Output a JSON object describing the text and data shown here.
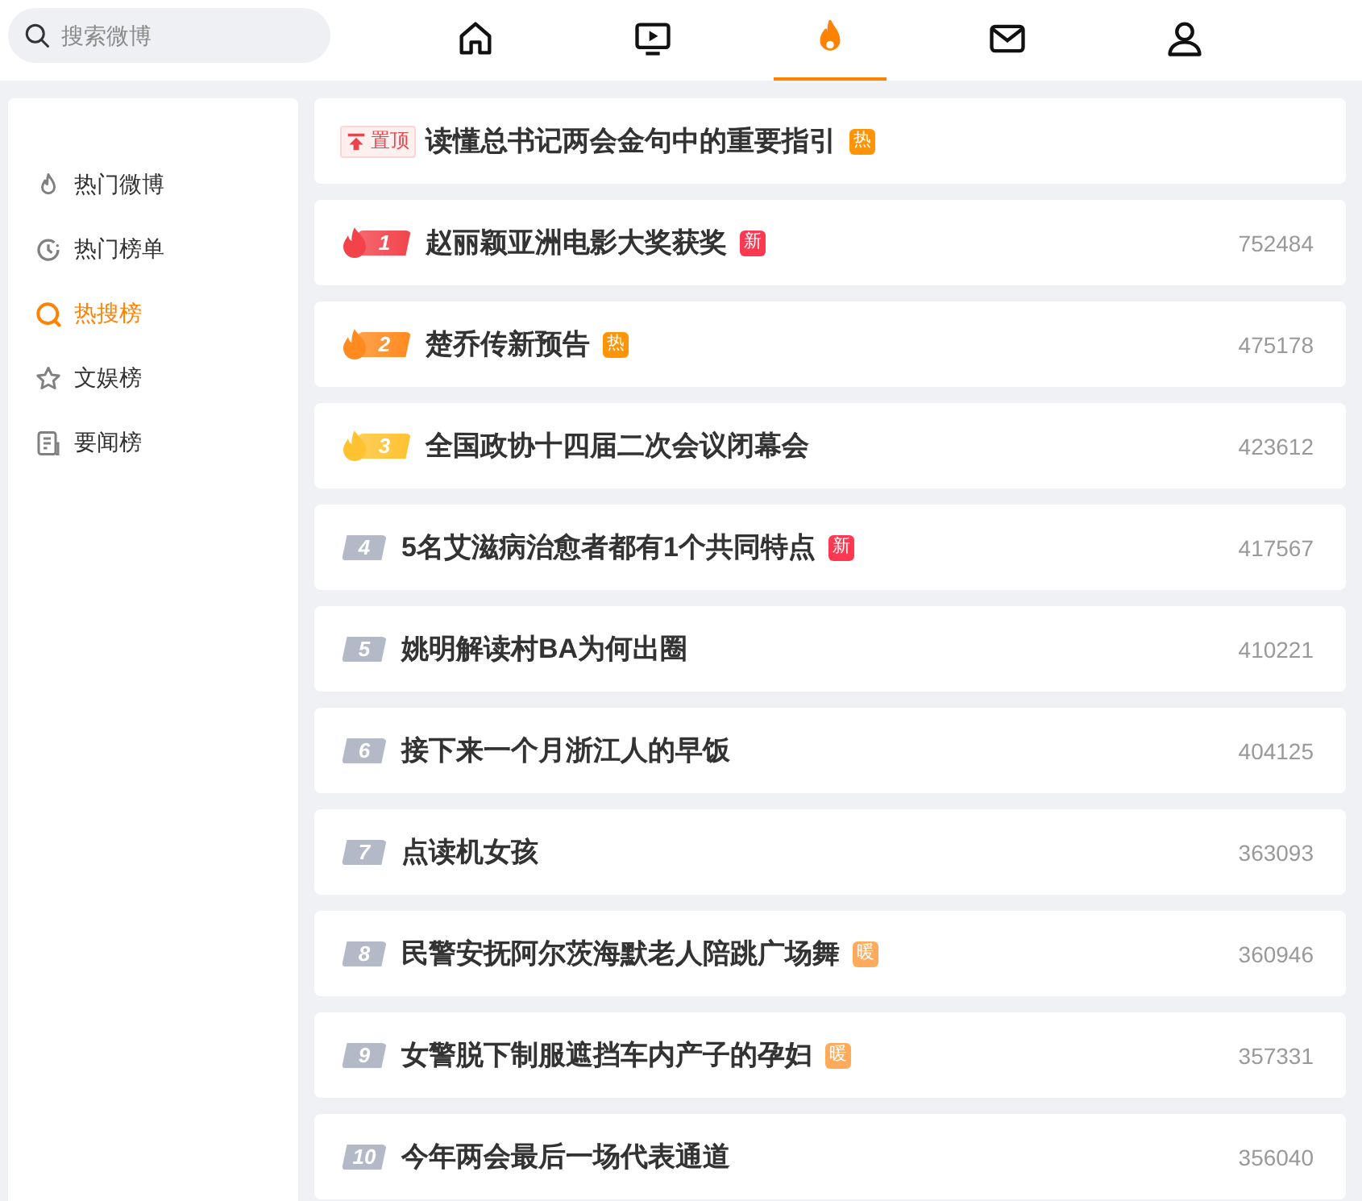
{
  "search": {
    "placeholder": "搜索微博"
  },
  "nav": [
    {
      "kind": "home",
      "selected": false
    },
    {
      "kind": "video",
      "selected": false
    },
    {
      "kind": "hot",
      "selected": true
    },
    {
      "kind": "mail",
      "selected": false
    },
    {
      "kind": "profile",
      "selected": false
    }
  ],
  "sidebar": {
    "items": [
      {
        "kind": "flame",
        "label": "热门微博",
        "selected": false
      },
      {
        "kind": "clock",
        "label": "热门榜单",
        "selected": false
      },
      {
        "kind": "search",
        "label": "热搜榜",
        "selected": true
      },
      {
        "kind": "star",
        "label": "文娱榜",
        "selected": false
      },
      {
        "kind": "doc",
        "label": "要闻榜",
        "selected": false
      }
    ]
  },
  "pinned": {
    "label": "置顶",
    "title": "读懂总书记两会金句中的重要指引",
    "tag": {
      "kind": "hot",
      "text": "热"
    }
  },
  "hot_list": [
    {
      "rank": "1",
      "flame": true,
      "color": "#f2434b",
      "title": "赵丽颖亚洲电影大奖获奖",
      "tag": {
        "kind": "new",
        "text": "新"
      },
      "count": "752484"
    },
    {
      "rank": "2",
      "flame": true,
      "color": "#ff8a1f",
      "title": "楚乔传新预告",
      "tag": {
        "kind": "hot",
        "text": "热"
      },
      "count": "475178"
    },
    {
      "rank": "3",
      "flame": true,
      "color": "#ffc230",
      "title": "全国政协十四届二次会议闭幕会",
      "count": "423612"
    },
    {
      "rank": "4",
      "flame": false,
      "color": "#b4b9c8",
      "title": "5名艾滋病治愈者都有1个共同特点",
      "tag": {
        "kind": "new",
        "text": "新"
      },
      "count": "417567"
    },
    {
      "rank": "5",
      "flame": false,
      "color": "#b4b9c8",
      "title": "姚明解读村BA为何出圈",
      "count": "410221"
    },
    {
      "rank": "6",
      "flame": false,
      "color": "#b4b9c8",
      "title": "接下来一个月浙江人的早饭",
      "count": "404125"
    },
    {
      "rank": "7",
      "flame": false,
      "color": "#b4b9c8",
      "title": "点读机女孩",
      "count": "363093"
    },
    {
      "rank": "8",
      "flame": false,
      "color": "#b4b9c8",
      "title": "民警安抚阿尔茨海默老人陪跳广场舞",
      "tag": {
        "kind": "warm",
        "text": "暖"
      },
      "count": "360946"
    },
    {
      "rank": "9",
      "flame": false,
      "color": "#b4b9c8",
      "title": "女警脱下制服遮挡车内产子的孕妇",
      "tag": {
        "kind": "warm",
        "text": "暖"
      },
      "count": "357331"
    },
    {
      "rank": "10",
      "flame": false,
      "color": "#b4b9c8",
      "title": "今年两会最后一场代表通道",
      "count": "356040"
    }
  ]
}
